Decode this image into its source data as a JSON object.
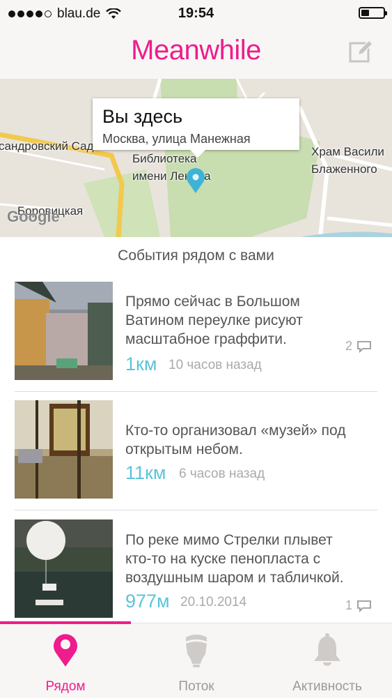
{
  "status_bar": {
    "carrier": "blau.de",
    "time": "19:54"
  },
  "header": {
    "title": "Meanwhile",
    "compose_icon": "compose-icon"
  },
  "map": {
    "callout": {
      "title": "Вы здесь",
      "subtitle": "Москва, улица Манежная"
    },
    "labels": [
      "сандровский Сад",
      "Библиотека",
      "имени Ленина",
      "Храм Васили",
      "Блаженного",
      "Боровицкая",
      "Google"
    ]
  },
  "section_title": "События рядом с вами",
  "items": [
    {
      "text": [
        "Прямо сейчас в Большом",
        "Ватином переулке рисуют",
        "масштабное граффити."
      ],
      "distance": "1км",
      "time": "10 часов назад",
      "comments": "2"
    },
    {
      "text": [
        "Кто-то организовал «музей» под",
        "открытым небом."
      ],
      "distance": "11км",
      "time": "6 часов назад",
      "comments": ""
    },
    {
      "text": [
        "По реке мимо Стрелки плывет",
        "кто-то на куске пенопласта с",
        "воздушным шаром и табличкой."
      ],
      "distance": "977м",
      "time": "20.10.2014",
      "comments": "1"
    }
  ],
  "tabs": [
    {
      "label": "Рядом",
      "icon": "location-pin-icon",
      "active": true
    },
    {
      "label": "Поток",
      "icon": "lightbulb-icon",
      "active": false
    },
    {
      "label": "Активность",
      "icon": "bell-icon",
      "active": false
    }
  ],
  "colors": {
    "accent": "#ee1c8c",
    "distance": "#5cc4d8",
    "bar_bg": "#f8f6f5"
  }
}
